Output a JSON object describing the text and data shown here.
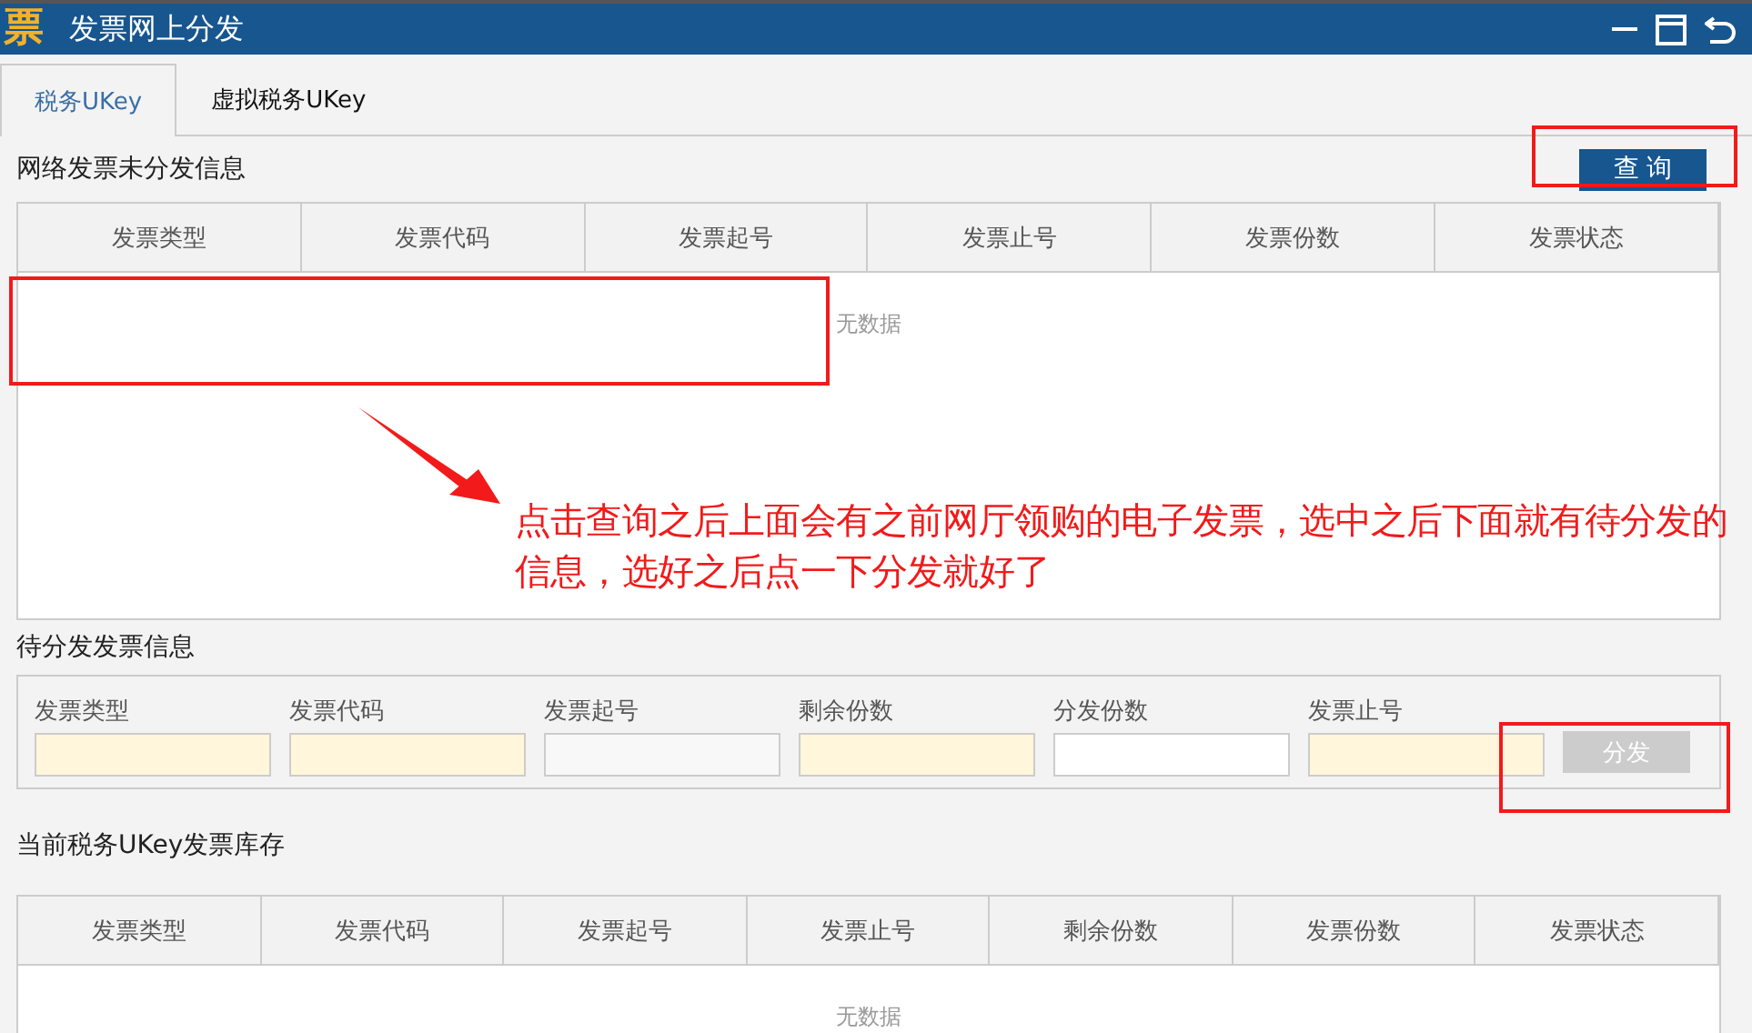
{
  "window": {
    "logo_text": "票",
    "title": "发票网上分发"
  },
  "tabs": [
    {
      "label": "税务UKey",
      "selected": true
    },
    {
      "label": "虚拟税务UKey",
      "selected": false
    }
  ],
  "undistributed": {
    "title": "网络发票未分发信息",
    "query_button": "查 询",
    "columns": [
      "发票类型",
      "发票代码",
      "发票起号",
      "发票止号",
      "发票份数",
      "发票状态"
    ],
    "empty_text": "无数据"
  },
  "pending": {
    "title": "待分发发票信息",
    "fields": [
      {
        "label": "发票类型",
        "kind": "readonly"
      },
      {
        "label": "发票代码",
        "kind": "readonly"
      },
      {
        "label": "发票起号",
        "kind": "disabled"
      },
      {
        "label": "剩余份数",
        "kind": "readonly"
      },
      {
        "label": "分发份数",
        "kind": "editable"
      },
      {
        "label": "发票止号",
        "kind": "readonly"
      }
    ],
    "button": {
      "label": "分发",
      "disabled": true
    }
  },
  "stock": {
    "title": "当前税务UKey发票库存",
    "columns": [
      "发票类型",
      "发票代码",
      "发票起号",
      "发票止号",
      "剩余份数",
      "发票份数",
      "发票状态"
    ],
    "empty_text": "无数据"
  },
  "annotation": {
    "text": "点击查询之后上面会有之前网厅领购的电子发票，选中之后下面就有待分发的信息，选好之后点一下分发就好了"
  }
}
